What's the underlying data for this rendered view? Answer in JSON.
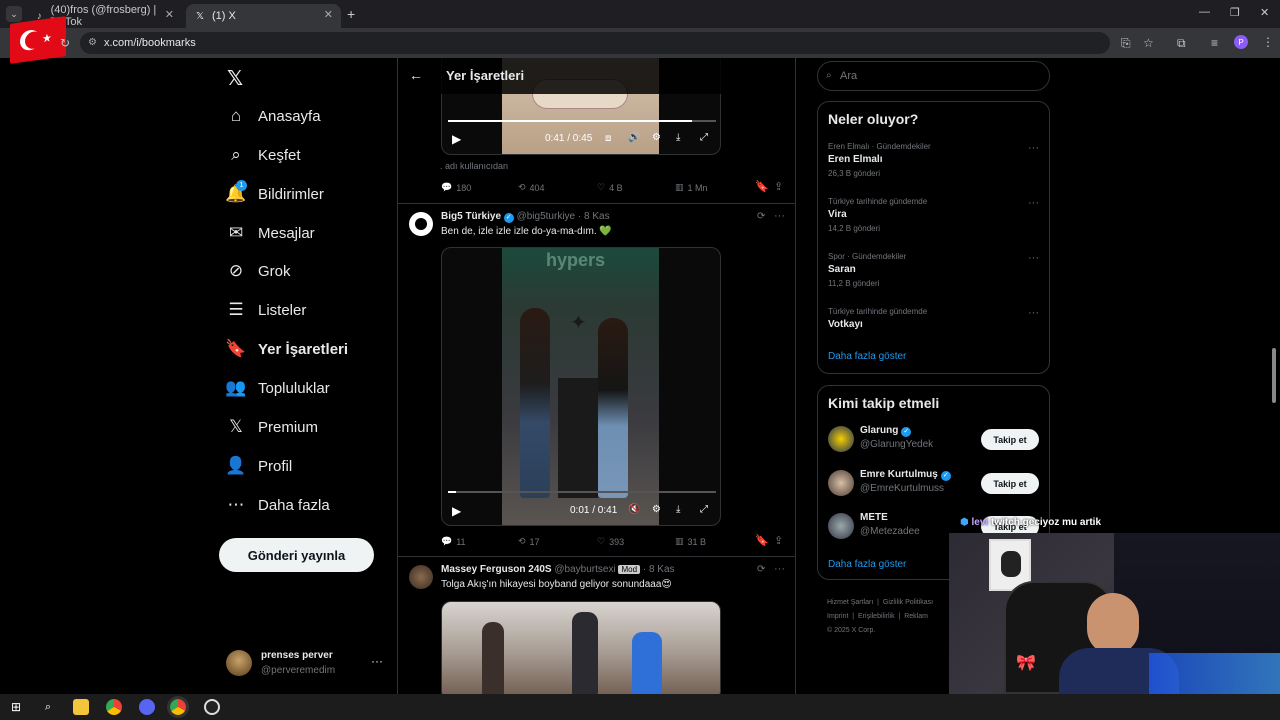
{
  "browser": {
    "tabs": [
      {
        "label": "(40)fros (@frosberg) | TikTok",
        "icon": "tiktok-icon"
      },
      {
        "label": "(1) X",
        "icon": "x-logo-icon"
      }
    ],
    "url": "x.com/i/bookmarks"
  },
  "nav": {
    "items": [
      {
        "label": "Anasayfa",
        "icon": "home-icon"
      },
      {
        "label": "Keşfet",
        "icon": "search-icon"
      },
      {
        "label": "Bildirimler",
        "icon": "bell-icon",
        "badge": "1"
      },
      {
        "label": "Mesajlar",
        "icon": "mail-icon"
      },
      {
        "label": "Grok",
        "icon": "grok-icon"
      },
      {
        "label": "Listeler",
        "icon": "list-icon"
      },
      {
        "label": "Yer İşaretleri",
        "icon": "bookmark-icon"
      },
      {
        "label": "Topluluklar",
        "icon": "communities-icon"
      },
      {
        "label": "Premium",
        "icon": "x-logo-icon"
      },
      {
        "label": "Profil",
        "icon": "person-icon"
      },
      {
        "label": "Daha fazla",
        "icon": "more-circle-icon"
      }
    ],
    "post_button": "Gönderi yayınla",
    "account": {
      "name": "prenses perver",
      "handle": "@perveremedim"
    }
  },
  "header": {
    "title": "Yer İşaretleri"
  },
  "posts": [
    {
      "video_time": "0:41 / 0:45",
      "caption": ". adı kullanıcıdan",
      "replies": "180",
      "reposts": "404",
      "likes": "4 B",
      "views": "1 Mn"
    },
    {
      "author": "Big5 Türkiye",
      "handle": "@big5turkiye",
      "date": "8 Kas",
      "text": "Ben de, izle izle izle do-ya-ma-dım. 💚",
      "video_watermark": "hypers",
      "video_time": "0:01 / 0:41",
      "replies": "11",
      "reposts": "17",
      "likes": "393",
      "views": "31 B"
    },
    {
      "author": "Massey Ferguson 240S",
      "handle": "@bayburtsexi",
      "badge": "Mod",
      "date": "8 Kas",
      "text": "Tolga Akış'ın hikayesi boyband geliyor sonundaaa😍"
    }
  ],
  "search": {
    "placeholder": "Ara"
  },
  "trends": {
    "title": "Neler oluyor?",
    "items": [
      {
        "meta": "Eren Elmalı · Gündemdekiler",
        "name": "Eren Elmalı",
        "count": "26,3 B gönderi"
      },
      {
        "meta": "Türkiye tarihinde gündemde",
        "name": "Vira",
        "count": "14,2 B gönderi"
      },
      {
        "meta": "Spor · Gündemdekiler",
        "name": "Saran",
        "count": "11,2 B gönderi"
      },
      {
        "meta": "Türkiye tarihinde gündemde",
        "name": "Votkayı",
        "count": ""
      }
    ],
    "show_more": "Daha fazla göster"
  },
  "follow": {
    "title": "Kimi takip etmeli",
    "items": [
      {
        "name": "Glarung",
        "handle": "@GlarungYedek",
        "verified": true
      },
      {
        "name": "Emre Kurtulmuş",
        "handle": "@EmreKurtulmuss",
        "verified": true
      },
      {
        "name": "METE",
        "handle": "@Metezadee",
        "verified": false
      }
    ],
    "follow_label": "Takip et",
    "show_more": "Daha fazla göster"
  },
  "footer": {
    "links": [
      "Hizmet Şartları",
      "Gizlilik Politikası",
      "Imprint",
      "Erişilebilirlik",
      "Reklam"
    ],
    "copyright": "© 2025 X Corp."
  },
  "stream_chat": {
    "user": "levi",
    "message": "twitch geciyoz mu artik"
  },
  "colors": {
    "accent": "#1d9bf0",
    "bg": "#000000",
    "border": "#2f3336",
    "muted": "#71767b",
    "like_green": "#00ba7c"
  }
}
